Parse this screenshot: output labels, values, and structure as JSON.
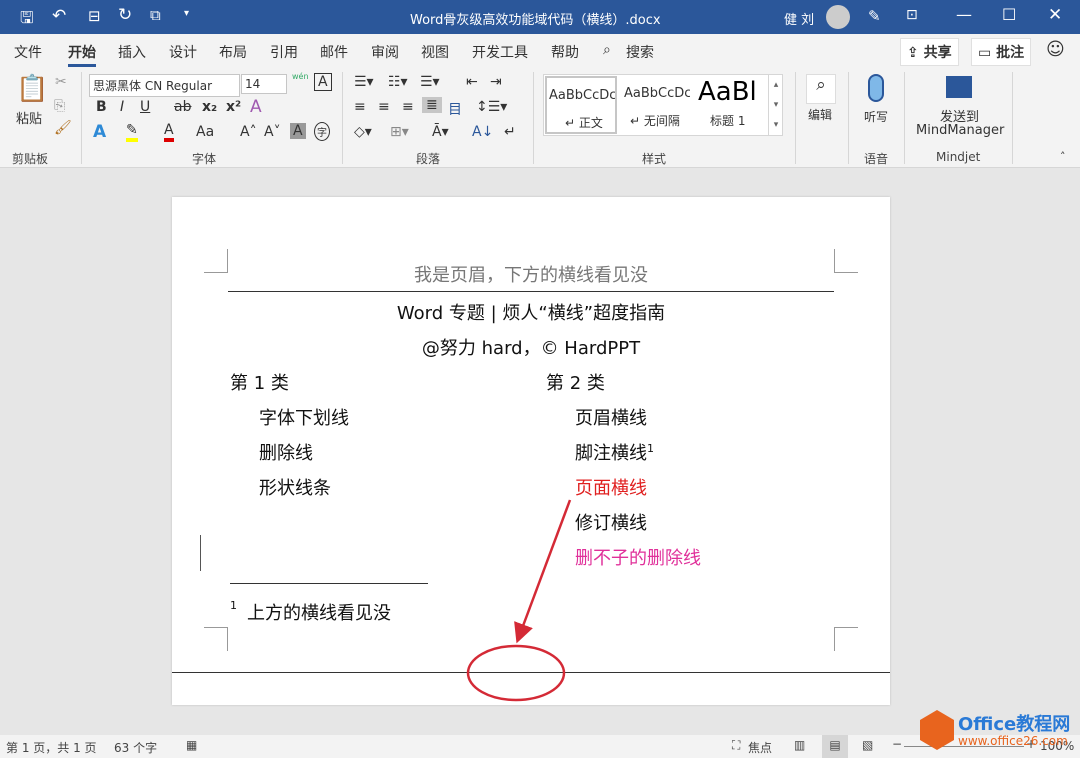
{
  "titlebar": {
    "title": "Word骨灰级高效功能域代码（横线）.docx",
    "user": "健 刘",
    "icons": [
      "save-icon",
      "undo-icon",
      "margins-icon",
      "redo-icon",
      "presentation-icon",
      "customize-icon"
    ]
  },
  "tabs": [
    "文件",
    "开始",
    "插入",
    "设计",
    "布局",
    "引用",
    "邮件",
    "审阅",
    "视图",
    "开发工具",
    "帮助"
  ],
  "search_label": "搜索",
  "share_label": "共享",
  "comment_label": "批注",
  "ribbon": {
    "clipboard": {
      "paste": "粘贴",
      "group": "剪贴板"
    },
    "font": {
      "name": "思源黑体 CN Regular",
      "size": "14",
      "group": "字体",
      "bold": "B",
      "italic": "I",
      "underline": "U",
      "strike": "ab",
      "sub": "x₂",
      "sup": "x²",
      "case": "Aa",
      "grow": "A˄",
      "shrink": "A˅",
      "shade": "A",
      "phonetic": "wén",
      "enclose": "字"
    },
    "paragraph": {
      "group": "段落"
    },
    "styles": {
      "group": "样式",
      "items": [
        {
          "preview": "AaBbCcDc",
          "label": "↵ 正文"
        },
        {
          "preview": "AaBbCcDc",
          "label": "↵ 无间隔"
        },
        {
          "preview": "AaBl",
          "label": "标题 1"
        }
      ]
    },
    "editing": {
      "label": "编辑"
    },
    "voice": {
      "label": "听写",
      "group": "语音"
    },
    "mindjet": {
      "label1": "发送到",
      "label2": "MindManager",
      "group": "Mindjet"
    }
  },
  "document": {
    "header": "我是页眉，下方的横线看见没",
    "title": "Word 专题 | 烦人“横线”超度指南",
    "subtitle": "@努力 hard，© HardPPT",
    "col1": {
      "heading": "第 1 类",
      "items": [
        "字体下划线",
        "删除线",
        "形状线条"
      ]
    },
    "col2": {
      "heading": "第 2 类",
      "items": [
        {
          "text": "页眉横线",
          "color": "#111111"
        },
        {
          "text": "脚注横线",
          "sup": "1",
          "color": "#111111"
        },
        {
          "text": "页面横线",
          "color": "#e02020"
        },
        {
          "text": "修订横线",
          "color": "#111111"
        },
        {
          "text": "删不子的删除线",
          "color": "#e0309a"
        }
      ]
    },
    "footnote": {
      "num": "1",
      "text": "上方的横线看见没"
    },
    "annotation_color": "#d42a36"
  },
  "status": {
    "page": "第 1 页，共 1 页",
    "words": "63 个字",
    "focus": "焦点",
    "zoom": "100%"
  },
  "watermark": {
    "brand": "Office教程网",
    "url": "www.office26.com"
  }
}
